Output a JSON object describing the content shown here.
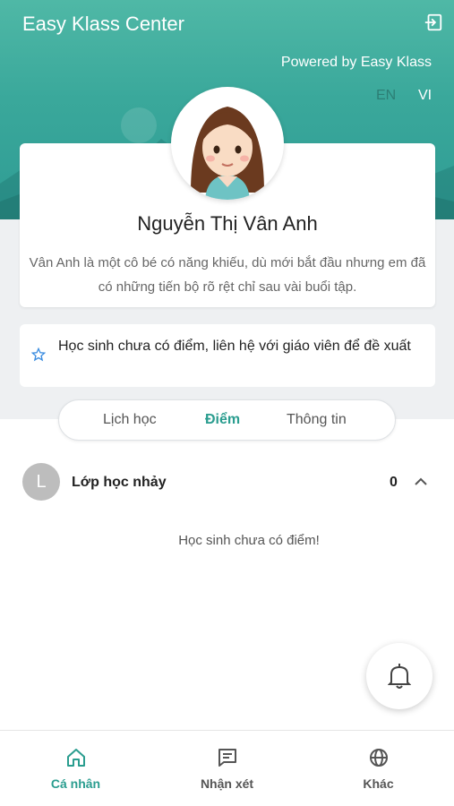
{
  "header": {
    "app_title": "Easy Klass Center",
    "powered_by": "Powered by Easy Klass",
    "languages": [
      "EN",
      "VI"
    ],
    "selected_language": "VI",
    "logout_icon": "logout-icon"
  },
  "profile": {
    "name": "Nguyễn Thị Vân Anh",
    "description": "Vân Anh là một cô bé có năng khiếu, dù mới bắt đầu nhưng em đã có những tiến bộ rõ rệt chỉ sau vài buổi tập.",
    "avatar_icon": "girl-avatar"
  },
  "notice": {
    "icon": "star-icon",
    "text": "Học sinh chưa có điểm, liên hệ với giáo viên để đề xuất"
  },
  "tabs": [
    {
      "label": "Lịch học",
      "active": false
    },
    {
      "label": "Điểm",
      "active": true
    },
    {
      "label": "Thông tin",
      "active": false
    }
  ],
  "class_section": {
    "avatar_letter": "L",
    "name": "Lớp học nhảy",
    "score": "0",
    "empty_message": "Học sinh chưa có điểm!"
  },
  "fab": {
    "icon": "bell-icon"
  },
  "bottom_nav": [
    {
      "label": "Cá nhân",
      "icon": "home-icon",
      "active": true
    },
    {
      "label": "Nhận xét",
      "icon": "comment-icon",
      "active": false
    },
    {
      "label": "Khác",
      "icon": "globe-icon",
      "active": false
    }
  ],
  "colors": {
    "accent": "#2a9d8f",
    "header": "#3aa89b"
  }
}
